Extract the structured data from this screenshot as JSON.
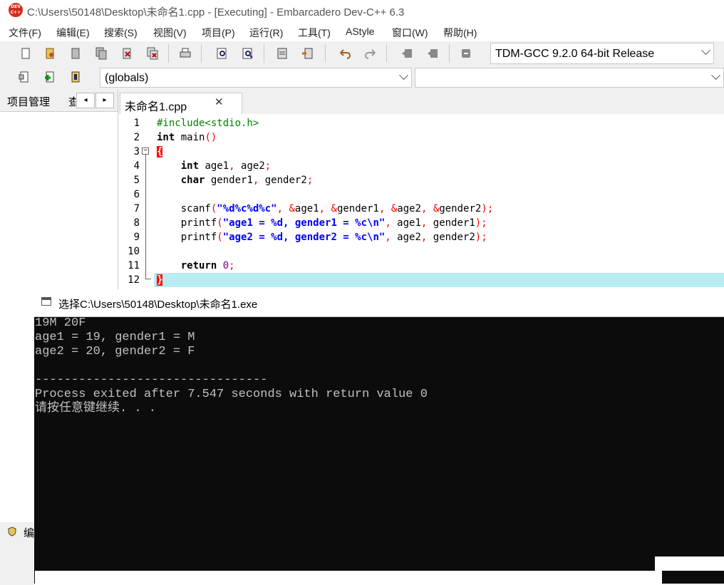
{
  "window": {
    "title": "C:\\Users\\50148\\Desktop\\未命名1.cpp - [Executing] - Embarcadero Dev-C++ 6.3",
    "logo_text": "DEV C++"
  },
  "menu": [
    "文件(F)",
    "编辑(E)",
    "搜索(S)",
    "视图(V)",
    "项目(P)",
    "运行(R)",
    "工具(T)",
    "AStyle",
    "窗口(W)",
    "帮助(H)"
  ],
  "toolbar": {
    "compiler": "TDM-GCC 9.2.0 64-bit Release",
    "scope": "(globals)",
    "class_select": ""
  },
  "left_panel": {
    "tab1": "项目管理",
    "tab2": "查",
    "prev": "◂",
    "next": "▸"
  },
  "editor": {
    "tab_name": "未命名1.cpp",
    "tab_close": "✕",
    "line_numbers": [
      "1",
      "2",
      "3",
      "4",
      "5",
      "6",
      "7",
      "8",
      "9",
      "10",
      "11",
      "12"
    ],
    "fold_symbol": "−"
  },
  "console": {
    "title": "选择C:\\Users\\50148\\Desktop\\未命名1.exe",
    "lines": [
      "19M 20F",
      "age1 = 19, gender1 = M",
      "age2 = 20, gender2 = F",
      "",
      "--------------------------------",
      "Process exited after 7.547 seconds with return value 0",
      "请按任意键继续. . ."
    ]
  },
  "bottom": {
    "label": "编"
  },
  "colors": {
    "highlight_line": "#b9ecf4",
    "preprocessor": "#008000",
    "string": "#0000ff",
    "operator": "#ff0000",
    "number": "#800080",
    "console_bg": "#0c0c0c"
  }
}
